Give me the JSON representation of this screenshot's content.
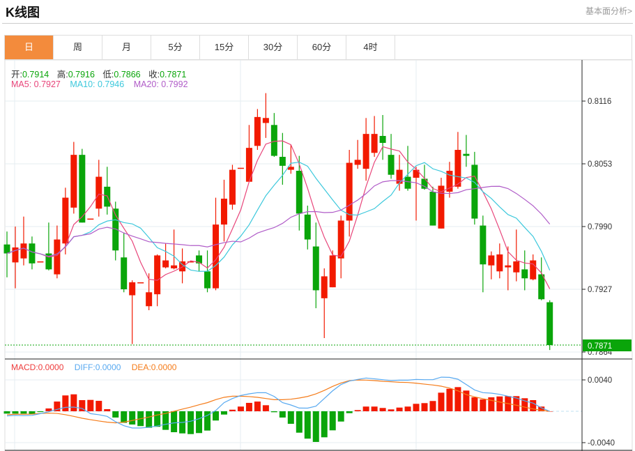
{
  "header": {
    "title": "K线图",
    "link": "基本面分析>"
  },
  "tabs": [
    {
      "label": "日",
      "active": true
    },
    {
      "label": "周"
    },
    {
      "label": "月"
    },
    {
      "label": "5分"
    },
    {
      "label": "15分"
    },
    {
      "label": "30分"
    },
    {
      "label": "60分"
    },
    {
      "label": "4时"
    }
  ],
  "info": {
    "open_label": "开:",
    "open": "0.7914",
    "high_label": "高:",
    "high": "0.7916",
    "low_label": "低:",
    "low": "0.7866",
    "close_label": "收:",
    "close": "0.7871",
    "ma5": "MA5: 0.7927",
    "ma10": "MA10: 0.7946",
    "ma20": "MA20: 0.7992"
  },
  "macd_legend": {
    "macd": "MACD:0.0000",
    "diff": "DIFF:0.0000",
    "dea": "DEA:0.0000"
  },
  "colors": {
    "up": "#f21a00",
    "down": "#0aa50a",
    "ma5": "#e8457a",
    "ma10": "#3cc8dc",
    "ma20": "#b05cc8",
    "diff": "#58a9f0",
    "dea": "#f57c1a",
    "accent": "#f38b3c"
  },
  "chart_data": {
    "type": "candlestick",
    "price_axis_ticks": [
      "0.8116",
      "0.8053",
      "0.7990",
      "0.7927",
      "0.7864"
    ],
    "last_price": "0.7871",
    "ohlc": [
      [
        0.7972,
        0.7985,
        0.7939,
        0.7963
      ],
      [
        0.7954,
        0.799,
        0.7928,
        0.7969
      ],
      [
        0.7958,
        0.8,
        0.7951,
        0.7973
      ],
      [
        0.7973,
        0.798,
        0.7947,
        0.7953
      ],
      [
        0.7954,
        0.7955,
        0.7954,
        0.7955
      ],
      [
        0.7963,
        0.7994,
        0.7946,
        0.7947
      ],
      [
        0.7942,
        0.7991,
        0.7938,
        0.7977
      ],
      [
        0.7973,
        0.8029,
        0.7962,
        0.8019
      ],
      [
        0.8009,
        0.8075,
        0.8003,
        0.8062
      ],
      [
        0.8062,
        0.8068,
        0.7994,
        0.7994
      ],
      [
        0.7998,
        0.7998,
        0.7998,
        0.7998
      ],
      [
        0.8008,
        0.8057,
        0.8,
        0.804
      ],
      [
        0.803,
        0.805,
        0.8002,
        0.801
      ],
      [
        0.8008,
        0.8015,
        0.7956,
        0.7966
      ],
      [
        0.7959,
        0.7984,
        0.7924,
        0.7927
      ],
      [
        0.7921,
        0.7936,
        0.7872,
        0.7934
      ],
      [
        0.7934,
        0.7934,
        0.7934,
        0.7934
      ],
      [
        0.791,
        0.7943,
        0.7906,
        0.7924
      ],
      [
        0.7922,
        0.7962,
        0.791,
        0.7961
      ],
      [
        0.7949,
        0.7973,
        0.7948,
        0.7956
      ],
      [
        0.7948,
        0.7987,
        0.7947,
        0.7951
      ],
      [
        0.7945,
        0.7968,
        0.7933,
        0.7955
      ],
      [
        0.7955,
        0.7955,
        0.7955,
        0.7955
      ],
      [
        0.7961,
        0.7966,
        0.7945,
        0.7953
      ],
      [
        0.7945,
        0.7966,
        0.7924,
        0.7928
      ],
      [
        0.7928,
        0.8019,
        0.7926,
        0.7992
      ],
      [
        0.7992,
        0.8037,
        0.7975,
        0.8018
      ],
      [
        0.8012,
        0.8052,
        0.8007,
        0.8047
      ],
      [
        0.8049,
        0.8049,
        0.8049,
        0.8049
      ],
      [
        0.8035,
        0.8092,
        0.8035,
        0.8069
      ],
      [
        0.8071,
        0.8108,
        0.8067,
        0.81
      ],
      [
        0.8094,
        0.8124,
        0.8079,
        0.8099
      ],
      [
        0.8092,
        0.8104,
        0.806,
        0.8061
      ],
      [
        0.806,
        0.8084,
        0.8032,
        0.8051
      ],
      [
        0.8047,
        0.8072,
        0.8043,
        0.805
      ],
      [
        0.8046,
        0.8061,
        0.7986,
        0.8003
      ],
      [
        0.8002,
        0.8011,
        0.7967,
        0.7977
      ],
      [
        0.797,
        0.7994,
        0.7908,
        0.7926
      ],
      [
        0.7918,
        0.7948,
        0.7878,
        0.794
      ],
      [
        0.7929,
        0.7966,
        0.7929,
        0.7961
      ],
      [
        0.7958,
        0.8001,
        0.7938,
        0.7996
      ],
      [
        0.7996,
        0.8067,
        0.798,
        0.8054
      ],
      [
        0.8052,
        0.8077,
        0.8048,
        0.8057
      ],
      [
        0.8048,
        0.8099,
        0.8036,
        0.8083
      ],
      [
        0.8064,
        0.8101,
        0.806,
        0.8083
      ],
      [
        0.8081,
        0.8102,
        0.8057,
        0.8074
      ],
      [
        0.8062,
        0.8083,
        0.8038,
        0.8042
      ],
      [
        0.8033,
        0.8062,
        0.8026,
        0.8047
      ],
      [
        0.804,
        0.8071,
        0.8026,
        0.8028
      ],
      [
        0.8039,
        0.805,
        0.7996,
        0.8047
      ],
      [
        0.8038,
        0.8052,
        0.8027,
        0.8028
      ],
      [
        0.8025,
        0.803,
        0.7991,
        0.7991
      ],
      [
        0.7988,
        0.8039,
        0.7988,
        0.8031
      ],
      [
        0.8025,
        0.8055,
        0.8019,
        0.8046
      ],
      [
        0.803,
        0.8085,
        0.8028,
        0.8067
      ],
      [
        0.8063,
        0.8082,
        0.805,
        0.8061
      ],
      [
        0.8052,
        0.8065,
        0.7992,
        0.7998
      ],
      [
        0.7991,
        0.8001,
        0.7924,
        0.7952
      ],
      [
        0.7951,
        0.7965,
        0.7937,
        0.7961
      ],
      [
        0.7945,
        0.7973,
        0.7938,
        0.7962
      ],
      [
        0.7949,
        0.797,
        0.7926,
        0.7951
      ],
      [
        0.7944,
        0.7987,
        0.7935,
        0.7955
      ],
      [
        0.7947,
        0.7966,
        0.7926,
        0.7938
      ],
      [
        0.7937,
        0.7962,
        0.7936,
        0.7956
      ],
      [
        0.7942,
        0.7959,
        0.7916,
        0.7917
      ],
      [
        0.7914,
        0.7916,
        0.7866,
        0.7871
      ]
    ],
    "macd_axis_ticks": [
      "0.0040",
      "-0.0040"
    ],
    "macd_hist": [
      -0.0003,
      -0.0003,
      -0.0003,
      -0.00036,
      -0.0001,
      0.00036,
      0.00124,
      0.00202,
      0.00216,
      0.00142,
      0.00145,
      0.00133,
      0.00027,
      -0.0008,
      -0.00148,
      -0.00169,
      -0.00189,
      -0.00211,
      -0.00198,
      -0.00237,
      -0.00267,
      -0.00282,
      -0.00291,
      -0.00278,
      -0.00246,
      -0.00118,
      -0.00042,
      0.0002,
      0.0006,
      0.00107,
      0.00124,
      0.00077,
      -0.00012,
      -0.0008,
      -0.0016,
      -0.00273,
      -0.00349,
      -0.00391,
      -0.00332,
      -0.00243,
      -0.00131,
      -0.00024,
      0.00015,
      0.0006,
      0.0006,
      0.00042,
      0.00024,
      0.00047,
      0.0006,
      0.00095,
      0.00104,
      0.00131,
      0.00237,
      0.00287,
      0.00308,
      0.00264,
      0.00178,
      0.00151,
      0.00178,
      0.00189,
      0.00193,
      0.00193,
      0.00166,
      0.00142,
      0.0006,
      0
    ],
    "diff": [
      -0.00059,
      -0.00053,
      -0.00056,
      -0.00053,
      -0.0003,
      -6e-05,
      0.00024,
      0.0005,
      0.00053,
      0.00036,
      -0.0003,
      -0.00044,
      -0.00065,
      -0.00133,
      -0.00184,
      -0.00213,
      -0.00213,
      -0.00204,
      -0.00187,
      -0.00166,
      -0.00148,
      -0.00142,
      -0.00127,
      -0.00095,
      -0.00053,
      0.0001,
      0.0011,
      0.00163,
      0.00201,
      0.00222,
      0.00237,
      0.00237,
      0.00189,
      0.0011,
      0.0008,
      0.00041,
      0.0004,
      0.00065,
      0.00163,
      0.00261,
      0.00341,
      0.00385,
      0.00406,
      0.00424,
      0.00414,
      0.00403,
      0.00391,
      0.00397,
      0.00397,
      0.00406,
      0.00403,
      0.00403,
      0.00435,
      0.00432,
      0.00409,
      0.00341,
      0.00272,
      0.00237,
      0.00231,
      0.00216,
      0.00192,
      0.00169,
      0.00133,
      0.00104,
      0.00044,
      0
    ],
    "dea": [
      -0.00044,
      -0.00038,
      -0.00038,
      -0.00036,
      -0.00027,
      -0.00024,
      -0.00027,
      -0.00044,
      -0.00065,
      -0.00089,
      -0.00107,
      -0.00124,
      -0.00139,
      -0.00148,
      -0.00139,
      -0.00118,
      -0.00095,
      -0.00074,
      -0.00047,
      -0.00027,
      0,
      0.00027,
      0.00053,
      0.00083,
      0.0011,
      0.00148,
      0.00178,
      0.00192,
      0.00192,
      0.00187,
      0.00178,
      0.00163,
      0.00148,
      0.00148,
      0.00154,
      0.00169,
      0.00189,
      0.00222,
      0.00266,
      0.00317,
      0.00361,
      0.0039,
      0.00399,
      0.00397,
      0.00391,
      0.00382,
      0.00376,
      0.0037,
      0.00367,
      0.00358,
      0.00346,
      0.00335,
      0.0032,
      0.00296,
      0.00261,
      0.00213,
      0.00184,
      0.0016,
      0.00139,
      0.00118,
      0.00098,
      0.00077,
      0.00053,
      0.0003,
      0.00012,
      0
    ]
  }
}
